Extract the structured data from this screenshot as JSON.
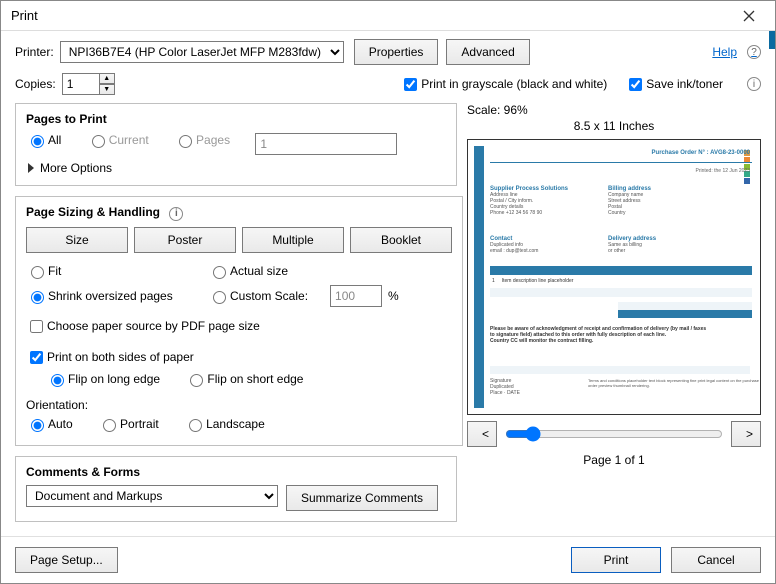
{
  "window": {
    "title": "Print",
    "help": "Help"
  },
  "printer": {
    "label": "Printer:",
    "selected": "NPI36B7E4 (HP Color LaserJet MFP M283fdw)",
    "properties": "Properties",
    "advanced": "Advanced"
  },
  "copies": {
    "label": "Copies:",
    "value": "1"
  },
  "options": {
    "grayscale": "Print in grayscale (black and white)",
    "save_ink": "Save ink/toner"
  },
  "pages": {
    "title": "Pages to Print",
    "all": "All",
    "current": "Current",
    "pages": "Pages",
    "pages_value": "1",
    "more": "More Options"
  },
  "sizing": {
    "title": "Page Sizing & Handling",
    "size": "Size",
    "poster": "Poster",
    "multiple": "Multiple",
    "booklet": "Booklet",
    "fit": "Fit",
    "actual": "Actual size",
    "shrink": "Shrink oversized pages",
    "custom": "Custom Scale:",
    "custom_value": "100",
    "percent": "%",
    "choose_source": "Choose paper source by PDF page size",
    "both_sides": "Print on both sides of paper",
    "flip_long": "Flip on long edge",
    "flip_short": "Flip on short edge",
    "orient_label": "Orientation:",
    "auto": "Auto",
    "portrait": "Portrait",
    "landscape": "Landscape"
  },
  "comments": {
    "title": "Comments & Forms",
    "selected": "Document and Markups",
    "summarize": "Summarize Comments"
  },
  "preview": {
    "scale_label": "Scale:  96%",
    "dimensions": "8.5 x 11 Inches",
    "po_title": "Purchase Order N° : AVG8-23-0000",
    "page_of": "Page 1 of 1",
    "prev": "<",
    "next": ">"
  },
  "buttons": {
    "page_setup": "Page Setup...",
    "print": "Print",
    "cancel": "Cancel"
  }
}
